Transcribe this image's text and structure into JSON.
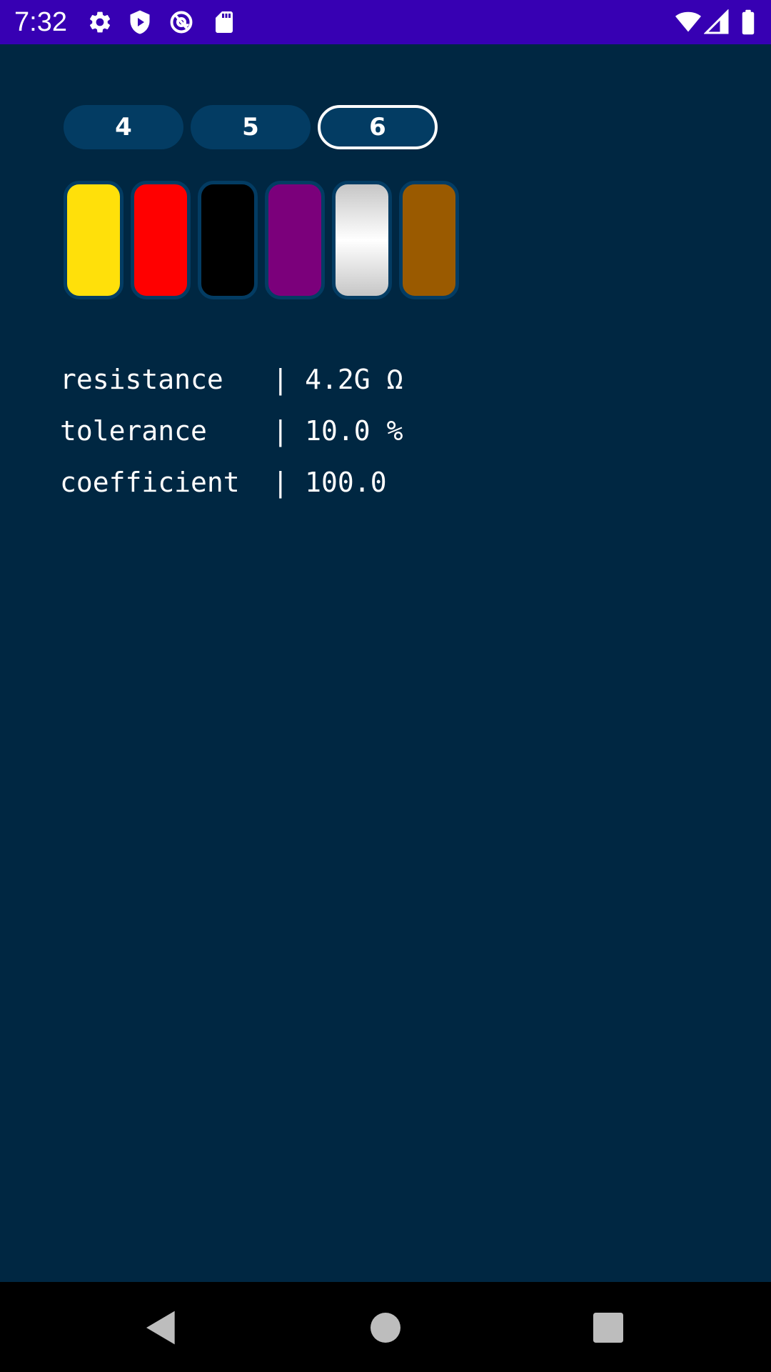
{
  "status_bar": {
    "time": "7:32",
    "background": "#3700B3",
    "left_icons": [
      "gear-icon",
      "play-protect-icon",
      "at-sign-icon",
      "sd-card-icon"
    ],
    "right_icons": [
      "wifi-icon",
      "signal-icon",
      "battery-icon"
    ]
  },
  "band_selector": {
    "options": [
      {
        "label": "4",
        "selected": false
      },
      {
        "label": "5",
        "selected": false
      },
      {
        "label": "6",
        "selected": true
      }
    ]
  },
  "bands": [
    {
      "color_name": "yellow",
      "color": "#FFE00A"
    },
    {
      "color_name": "red",
      "color": "#FF0000"
    },
    {
      "color_name": "black",
      "color": "#000000"
    },
    {
      "color_name": "violet",
      "color": "#7B007B"
    },
    {
      "color_name": "silver",
      "color": "#D8D8D8"
    },
    {
      "color_name": "brown",
      "color": "#9A5A00"
    }
  ],
  "results": {
    "resistance": {
      "label": "resistance   ",
      "value": "| 4.2G Ω"
    },
    "tolerance": {
      "label": "tolerance    ",
      "value": "| 10.0 %"
    },
    "coefficient": {
      "label": "coefficient  ",
      "value": "| 100.0"
    }
  },
  "colors": {
    "background": "#002742",
    "pill": "#033c63",
    "band_border": "#033c63",
    "text": "#FFFFFF"
  },
  "nav_bar": {
    "icons": [
      "back-icon",
      "home-icon",
      "recents-icon"
    ]
  }
}
